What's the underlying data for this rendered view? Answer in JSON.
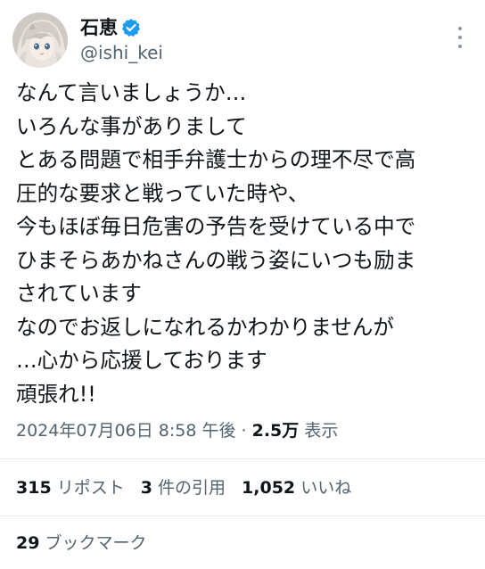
{
  "author": {
    "display_name": "石恵",
    "handle": "@ishi_kei",
    "verified_color": "#1d9bf0",
    "avatar_icon": "user-avatar-anime-girl"
  },
  "more_icon": "more-options-vertical-dots",
  "tweet": {
    "lines": [
      "なんて言いましょうか…",
      "いろんな事がありまして",
      "とある問題で相手弁護士からの理不尽で高",
      "圧的な要求と戦っていた時や、",
      "今もほぼ毎日危害の予告を受けている中で",
      "ひまそらあかねさんの戦う姿にいつも励ま",
      "されています",
      "なのでお返しになれるかわかりませんが",
      "…心から応援しております",
      "頑張れ!!"
    ]
  },
  "meta": {
    "timestamp": "2024年07月06日 8:58 午後",
    "separator": "·",
    "views_count": "2.5万",
    "views_label": "表示"
  },
  "stats": {
    "reposts_count": "315",
    "reposts_label": "リポスト",
    "quotes_count": "3",
    "quotes_label": "件の引用",
    "likes_count": "1,052",
    "likes_label": "いいね",
    "bookmarks_count": "29",
    "bookmarks_label": "ブックマーク"
  },
  "colors": {
    "text_primary": "#0f1419",
    "text_secondary": "#536471",
    "divider": "#e7e9eb"
  }
}
